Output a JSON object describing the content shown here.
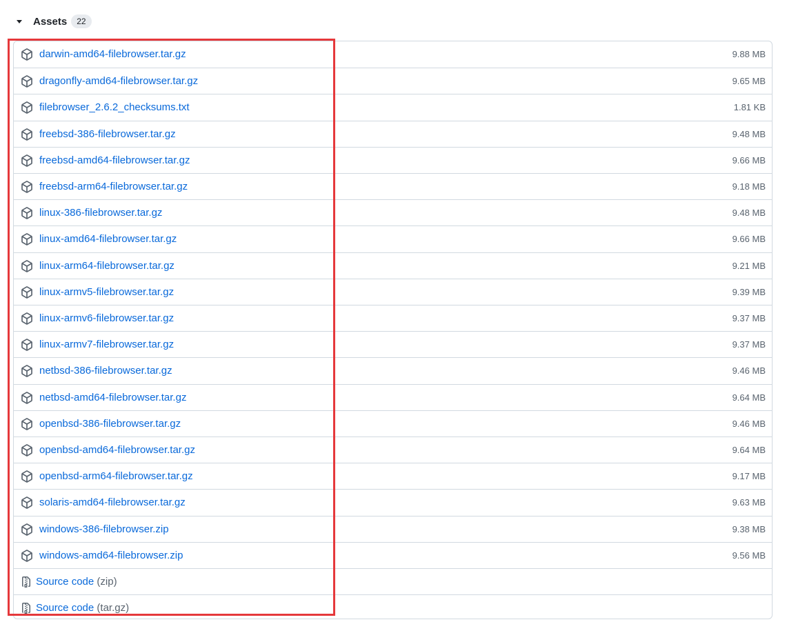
{
  "assets": {
    "title": "Assets",
    "count": "22",
    "items": [
      {
        "name": "darwin-amd64-filebrowser.tar.gz",
        "size": "9.88 MB"
      },
      {
        "name": "dragonfly-amd64-filebrowser.tar.gz",
        "size": "9.65 MB"
      },
      {
        "name": "filebrowser_2.6.2_checksums.txt",
        "size": "1.81 KB"
      },
      {
        "name": "freebsd-386-filebrowser.tar.gz",
        "size": "9.48 MB"
      },
      {
        "name": "freebsd-amd64-filebrowser.tar.gz",
        "size": "9.66 MB"
      },
      {
        "name": "freebsd-arm64-filebrowser.tar.gz",
        "size": "9.18 MB"
      },
      {
        "name": "linux-386-filebrowser.tar.gz",
        "size": "9.48 MB"
      },
      {
        "name": "linux-amd64-filebrowser.tar.gz",
        "size": "9.66 MB"
      },
      {
        "name": "linux-arm64-filebrowser.tar.gz",
        "size": "9.21 MB"
      },
      {
        "name": "linux-armv5-filebrowser.tar.gz",
        "size": "9.39 MB"
      },
      {
        "name": "linux-armv6-filebrowser.tar.gz",
        "size": "9.37 MB"
      },
      {
        "name": "linux-armv7-filebrowser.tar.gz",
        "size": "9.37 MB"
      },
      {
        "name": "netbsd-386-filebrowser.tar.gz",
        "size": "9.46 MB"
      },
      {
        "name": "netbsd-amd64-filebrowser.tar.gz",
        "size": "9.64 MB"
      },
      {
        "name": "openbsd-386-filebrowser.tar.gz",
        "size": "9.46 MB"
      },
      {
        "name": "openbsd-amd64-filebrowser.tar.gz",
        "size": "9.64 MB"
      },
      {
        "name": "openbsd-arm64-filebrowser.tar.gz",
        "size": "9.17 MB"
      },
      {
        "name": "solaris-amd64-filebrowser.tar.gz",
        "size": "9.63 MB"
      },
      {
        "name": "windows-386-filebrowser.zip",
        "size": "9.38 MB"
      },
      {
        "name": "windows-amd64-filebrowser.zip",
        "size": "9.56 MB"
      }
    ],
    "source_code": [
      {
        "label": "Source code",
        "ext": "(zip)"
      },
      {
        "label": "Source code",
        "ext": "(tar.gz)"
      }
    ]
  },
  "icons": {
    "asset": "package-icon",
    "source": "file-zip-icon",
    "toggle": "triangle-down-icon"
  },
  "colors": {
    "link": "#0969da",
    "muted": "#59636e",
    "border": "#d1d9e0",
    "highlight": "#e5383b",
    "badge_bg": "#e8ebef"
  }
}
